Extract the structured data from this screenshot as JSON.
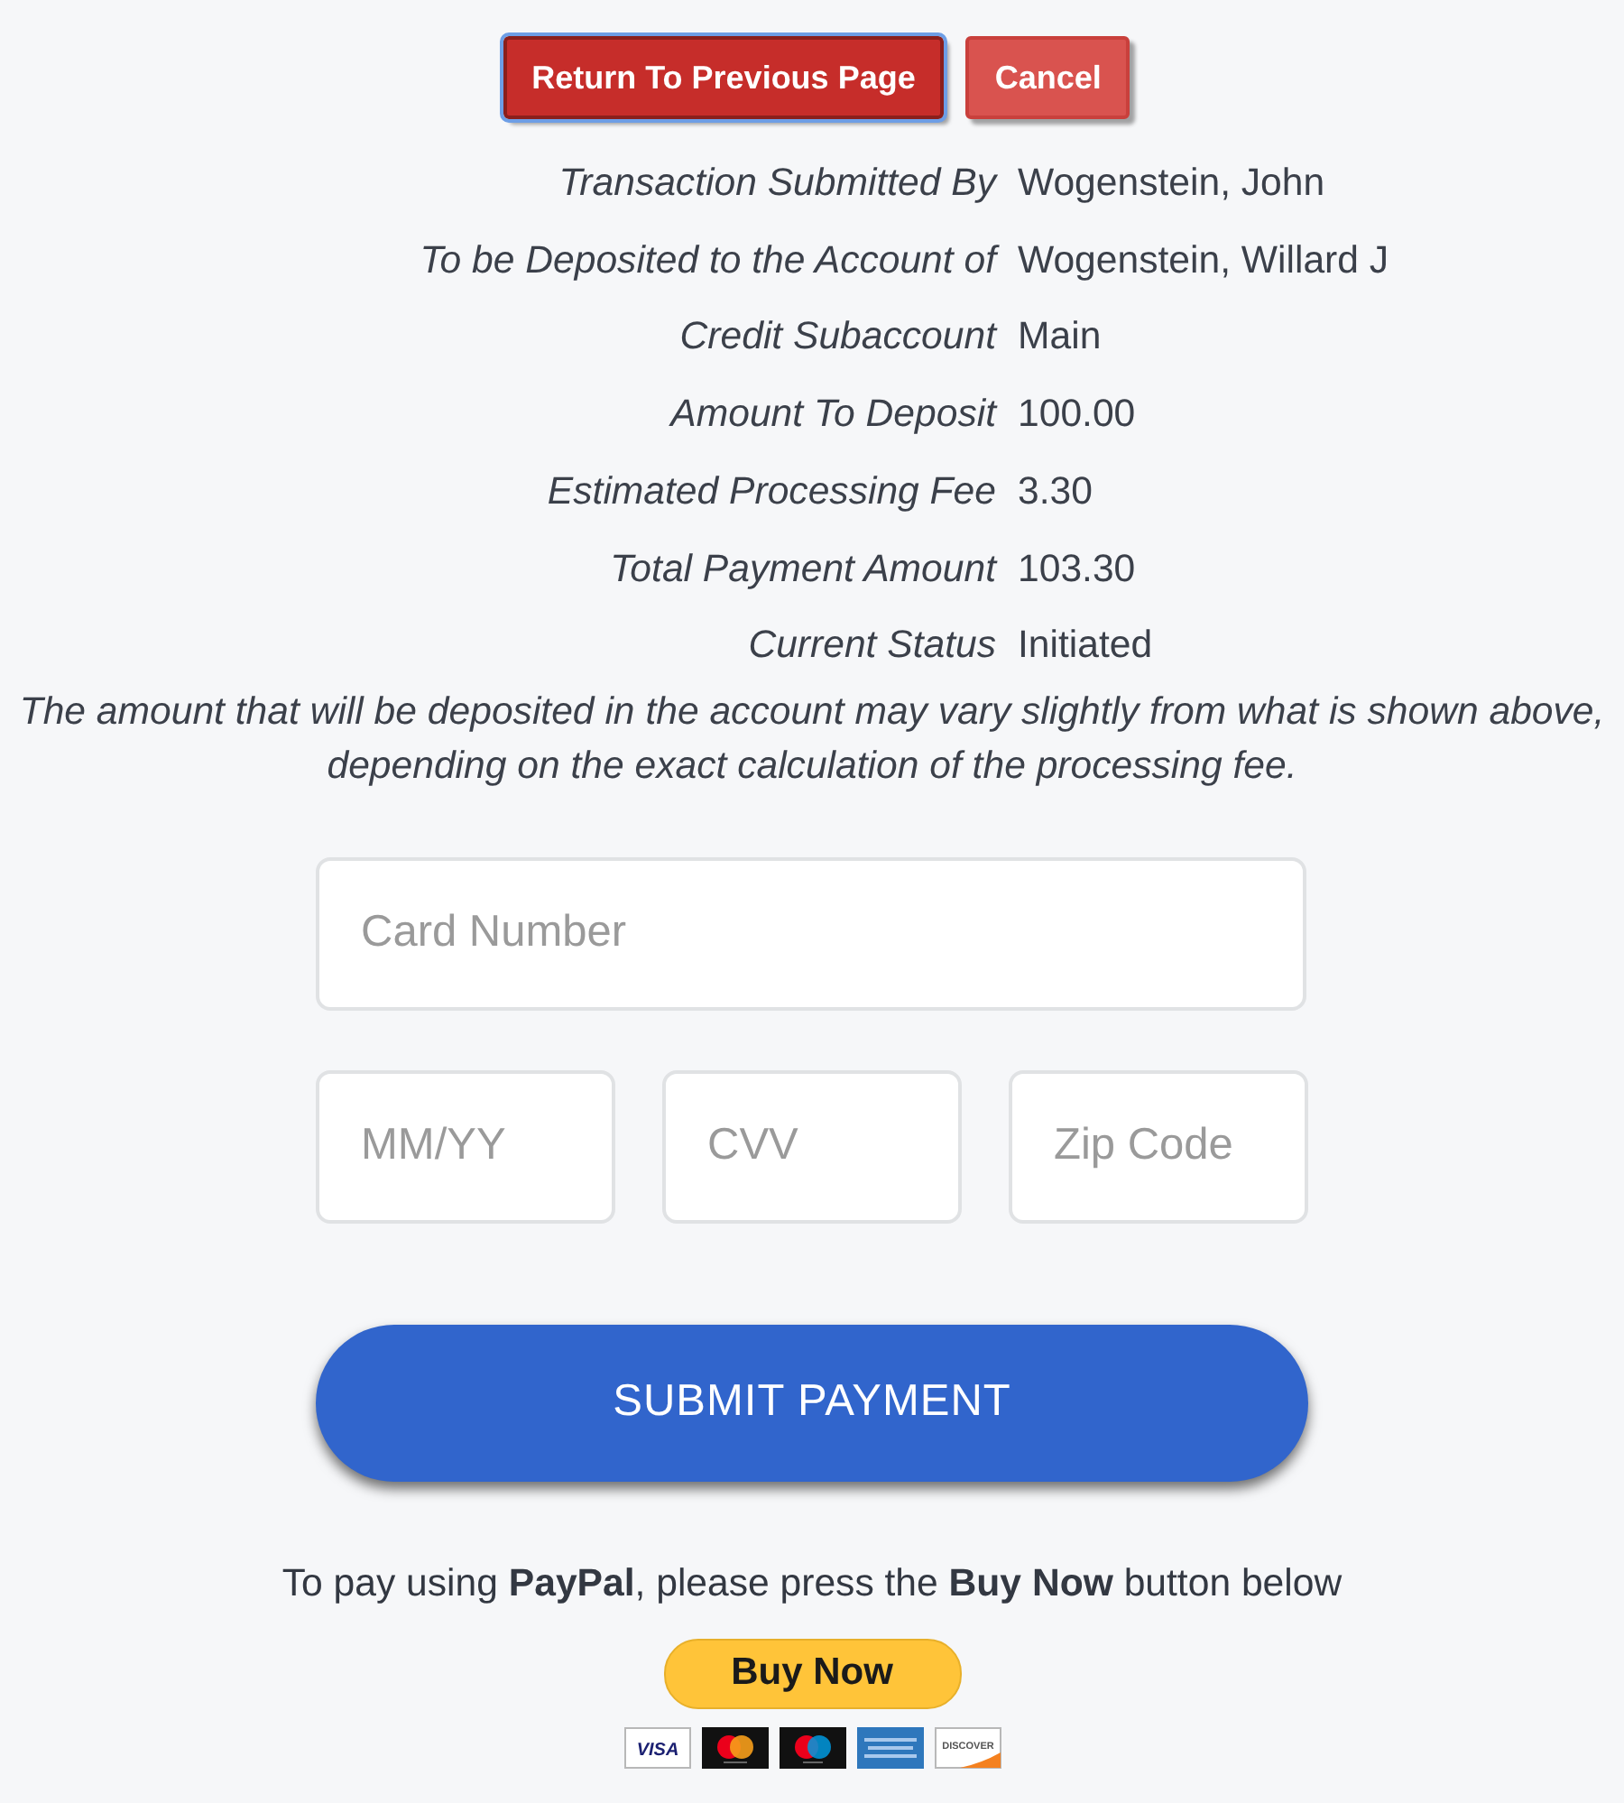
{
  "top_buttons": [
    {
      "label": "Return To Previous Page",
      "focused": true
    },
    {
      "label": "Cancel",
      "focused": false
    }
  ],
  "details": [
    {
      "label": "Transaction Submitted By",
      "value": "Wogenstein, John"
    },
    {
      "label": "To be Deposited to the Account of",
      "value": "Wogenstein, Willard J"
    },
    {
      "label": "Credit Subaccount",
      "value": "Main"
    },
    {
      "label": "Amount To Deposit",
      "value": "100.00"
    },
    {
      "label": "Estimated Processing Fee",
      "value": "3.30"
    },
    {
      "label": "Total Payment Amount",
      "value": "103.30"
    },
    {
      "label": "Current Status",
      "value": "Initiated"
    }
  ],
  "note": "The amount that will be deposited in the account may vary slightly from what is shown above, depending on the exact calculation of the processing fee.",
  "card_form": {
    "card_number": {
      "placeholder": "Card Number"
    },
    "fields": [
      {
        "placeholder": "MM/YY"
      },
      {
        "placeholder": "CVV"
      },
      {
        "placeholder": "Zip Code"
      }
    ],
    "submit_button": "SUBMIT PAYMENT"
  },
  "paypal": {
    "instructions": "To pay using **PayPal**, please press the **Buy Now** button below",
    "buy_button": "Buy Now",
    "card_logos": [
      {
        "kind": "visa",
        "label": "VISA"
      },
      {
        "kind": "mastercard"
      },
      {
        "kind": "maestro"
      },
      {
        "kind": "amex"
      },
      {
        "kind": "discover",
        "label": "DISCOVER"
      }
    ]
  }
}
